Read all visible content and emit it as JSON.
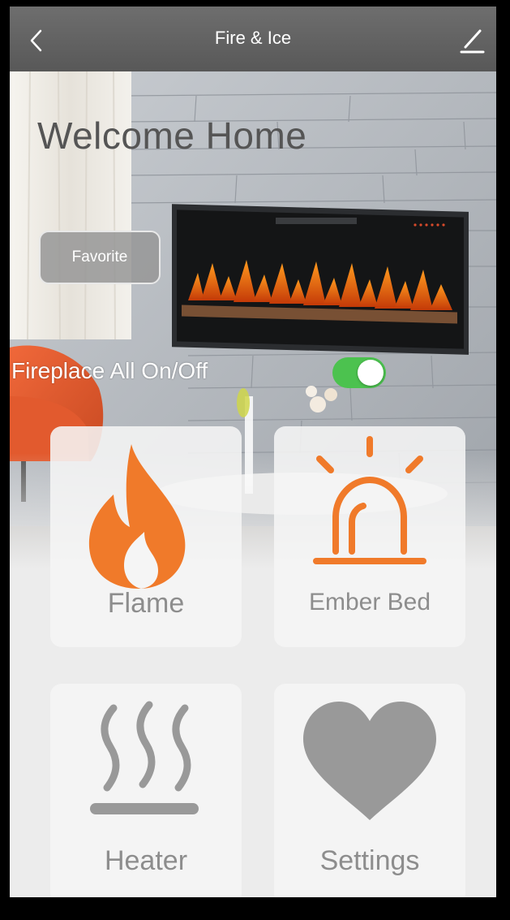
{
  "header": {
    "title": "Fire & Ice",
    "back_icon": "chevron-left-icon",
    "edit_icon": "pencil-icon"
  },
  "hero": {
    "welcome_text": "Welcome Home",
    "favorite_label": "Favorite",
    "all_toggle_label": "Fireplace All On/Off",
    "all_toggle_on": true
  },
  "tiles": [
    {
      "label": "Flame",
      "icon": "flame-icon",
      "color": "#f07a2a"
    },
    {
      "label": "Ember Bed",
      "icon": "alarm-light-icon",
      "color": "#f07a2a"
    },
    {
      "label": "Heater",
      "icon": "heat-waves-icon",
      "color": "#999999"
    },
    {
      "label": "Settings",
      "icon": "heart-icon",
      "color": "#999999"
    }
  ],
  "colors": {
    "accent": "#f07a2a",
    "toggle_on": "#4cc24f",
    "navbar": "#606060"
  }
}
